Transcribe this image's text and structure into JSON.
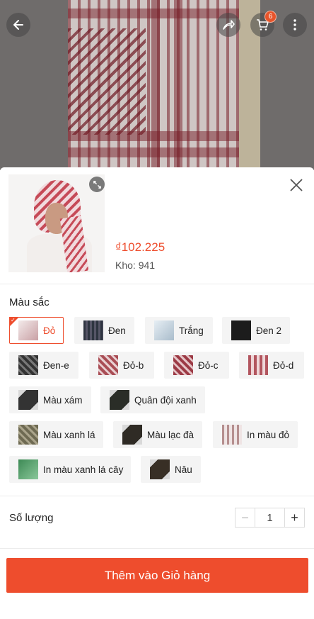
{
  "header": {
    "cart_count": "6",
    "icons": [
      "back-arrow-icon",
      "share-icon",
      "cart-icon",
      "more-icon"
    ]
  },
  "product": {
    "price": "₫102.225",
    "stock": "Kho: 941"
  },
  "variation": {
    "title": "Màu sắc",
    "selected": "Đỏ",
    "options": [
      {
        "label": "Đỏ",
        "swatch": "#d8c8c8"
      },
      {
        "label": "Đen",
        "swatch": "#3d4450"
      },
      {
        "label": "Trắng",
        "swatch": "#c9d6e0"
      },
      {
        "label": "Đen 2",
        "swatch": "#1e1e1e"
      },
      {
        "label": "Đen-e",
        "swatch": "#3a3a3a"
      },
      {
        "label": "Đỏ-b",
        "swatch": "#b86a70"
      },
      {
        "label": "Đỏ-c",
        "swatch": "#a84e58"
      },
      {
        "label": "Đỏ-d",
        "swatch": "#b2555e"
      },
      {
        "label": "Màu xám",
        "swatch": "#3c3c3c"
      },
      {
        "label": "Quân đội xanh",
        "swatch": "#2c2f28"
      },
      {
        "label": "Màu xanh lá",
        "swatch": "#6e6a52"
      },
      {
        "label": "Màu lạc đà",
        "swatch": "#34302a"
      },
      {
        "label": "In màu đỏ",
        "swatch": "#b58f8f"
      },
      {
        "label": "In màu xanh lá cây",
        "swatch": "#3d8a55"
      },
      {
        "label": "Nâu",
        "swatch": "#3a3228"
      }
    ]
  },
  "quantity": {
    "label": "Số lượng",
    "value": "1",
    "minus": "−",
    "plus": "+"
  },
  "actions": {
    "add_to_cart": "Thêm vào Giỏ hàng"
  },
  "colors": {
    "accent": "#ee4d2d"
  }
}
